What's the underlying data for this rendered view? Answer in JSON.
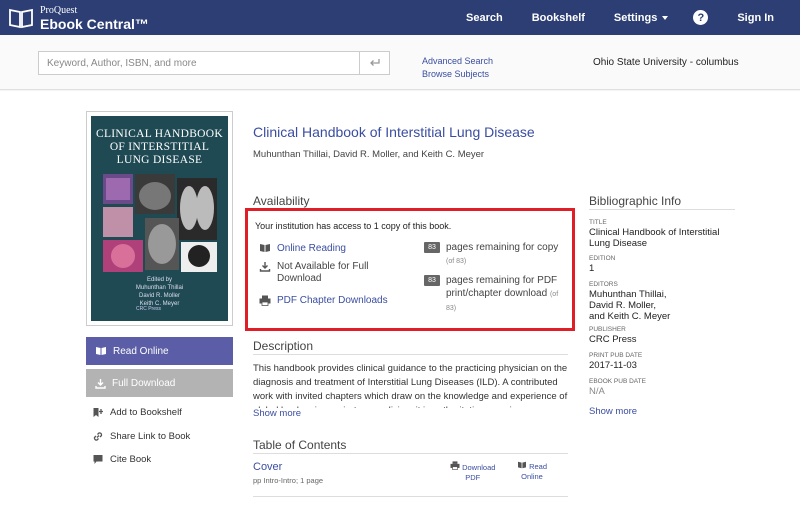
{
  "header": {
    "brand_sub": "ProQuest",
    "brand_main": "Ebook Central™",
    "nav": [
      {
        "label": "Search"
      },
      {
        "label": "Bookshelf"
      },
      {
        "label": "Settings"
      },
      {
        "label": "Sign In"
      }
    ],
    "help_glyph": "?"
  },
  "search": {
    "placeholder": "Keyword, Author, ISBN, and more",
    "advanced": "Advanced Search",
    "browse": "Browse Subjects",
    "institution": "Ohio State University - columbus"
  },
  "cover": {
    "title_lines": [
      "CLINICAL HANDBOOK",
      "OF INTERSTITIAL",
      "LUNG DISEASE"
    ],
    "edited_by": "Edited by",
    "authors": [
      "Muhunthan Thillai",
      "David R. Moller",
      "Keith C. Meyer"
    ],
    "publisher": "CRC Press"
  },
  "actions": {
    "read_online": "Read Online",
    "full_download": "Full Download",
    "add_bookshelf": "Add to Bookshelf",
    "share_link": "Share Link to Book",
    "cite_book": "Cite Book"
  },
  "book": {
    "title": "Clinical Handbook of Interstitial Lung Disease",
    "authors": "Muhunthan Thillai, David R. Moller, and Keith C. Meyer"
  },
  "availability": {
    "heading": "Availability",
    "intro": "Your institution has access to 1 copy of this book.",
    "online_reading": "Online Reading",
    "not_available_1": "Not Available for Full",
    "not_available_2": "Download",
    "pdf_chapter": "PDF Chapter Downloads",
    "copy_count": "83",
    "copy_text": "pages remaining for copy",
    "copy_of": "(of 83)",
    "pdf_count": "83",
    "pdf_text_1": "pages remaining for PDF",
    "pdf_text_2": "print/chapter download",
    "pdf_of_a": "(of",
    "pdf_of_b": "83)"
  },
  "description": {
    "heading": "Description",
    "text": "This handbook provides clinical guidance to the practicing physician on the diagnosis and treatment of Interstitial Lung Diseases (ILD). A contributed work with invited chapters which draw on the knowledge and experience of global leaders in respiratory medicine, it is authoritative, concise",
    "show_more": "Show more"
  },
  "toc": {
    "heading": "Table of Contents",
    "cover": "Cover",
    "cover_pages": "pp Intro-Intro; 1 page",
    "download_1": "Download",
    "download_2": "PDF",
    "read_1": "Read",
    "read_2": "Online"
  },
  "biblio": {
    "heading": "Bibliographic Info",
    "title_label": "TITLE",
    "title_1": "Clinical Handbook of Interstitial",
    "title_2": "Lung Disease",
    "edition_label": "EDITION",
    "edition": "1",
    "editors_label": "EDITORS",
    "editor_1": "Muhunthan Thillai,",
    "editor_2": "David R. Moller,",
    "editor_3": "and Keith C. Meyer",
    "publisher_label": "PUBLISHER",
    "publisher": "CRC Press",
    "print_pub_label": "PRINT PUB DATE",
    "print_pub": "2017-11-03",
    "ebook_pub_label": "EBOOK PUB DATE",
    "ebook_pub": "N/A",
    "show_more": "Show more"
  },
  "colors": {
    "nav_bg": "#2c3e73",
    "link": "#3a4ea0",
    "highlight": "#e01e27",
    "read_button": "#5b5ea6"
  }
}
